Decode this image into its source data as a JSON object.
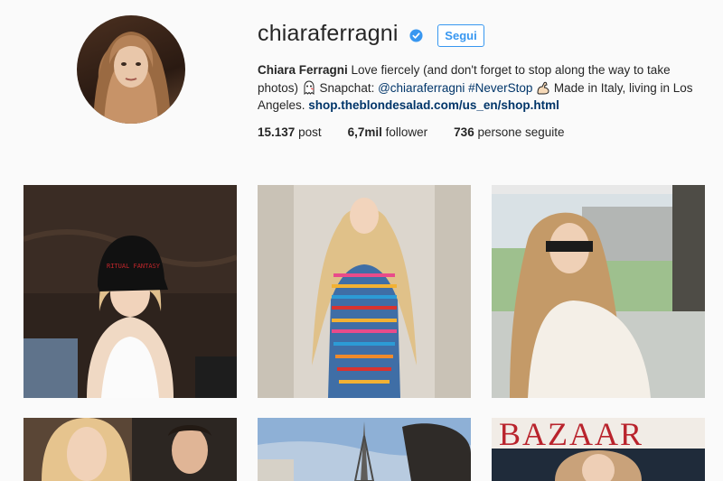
{
  "profile": {
    "username": "chiaraferragni",
    "follow_label": "Segui",
    "bio": {
      "name": "Chiara Ferragni",
      "text1": " Love fiercely (and don't forget to stop along the way to take photos) ",
      "text2": " Snapchat: ",
      "mention": "@chiaraferragni",
      "hashtag": "#NeverStop",
      "text3": " Made in Italy, living in Los Angeles. ",
      "link": "shop.theblondesalad.com/us_en/shop.html"
    },
    "stats": {
      "posts_value": "15.137",
      "posts_label": "post",
      "followers_value": "6,7mil",
      "followers_label": "follower",
      "following_value": "736",
      "following_label": "persone seguite"
    }
  },
  "posts": {
    "cap_text": "RITUAL FANTASY",
    "magazine_title": "BAZAAR"
  },
  "colors": {
    "accent": "#3897f0",
    "link": "#003569",
    "text": "#262626",
    "background": "#fafafa"
  },
  "icons": [
    "verified-badge-icon",
    "ghost-emoji-icon",
    "flexed-biceps-emoji-icon"
  ]
}
